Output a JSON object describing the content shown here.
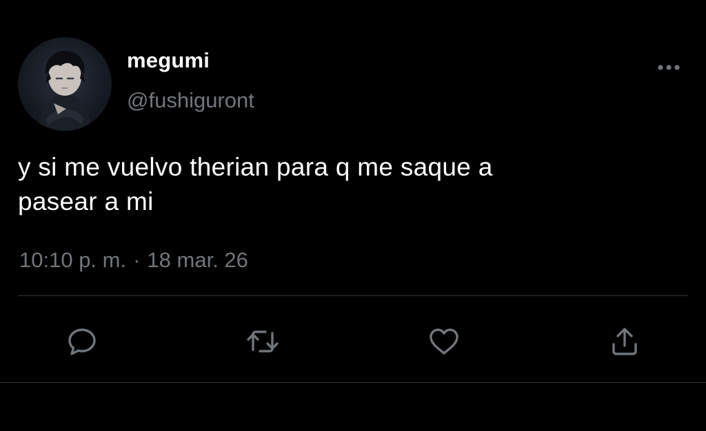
{
  "tweet": {
    "author": {
      "display_name": "megumi",
      "handle": "@fushiguront"
    },
    "text_line1": "y si me vuelvo therian para q me saque a",
    "text_line2": "pasear a mi",
    "time": "10:10 p. m.",
    "separator": "·",
    "date": "18 mar. 26"
  },
  "icons": {
    "more": "more-horizontal-icon",
    "reply": "reply-bubble-icon",
    "retweet": "retweet-icon",
    "like": "heart-icon",
    "share": "share-upload-icon"
  },
  "colors": {
    "background": "#000000",
    "primary_text": "#ffffff",
    "secondary_text": "#71767b",
    "divider": "#2f3336",
    "icon": "#71767b"
  }
}
